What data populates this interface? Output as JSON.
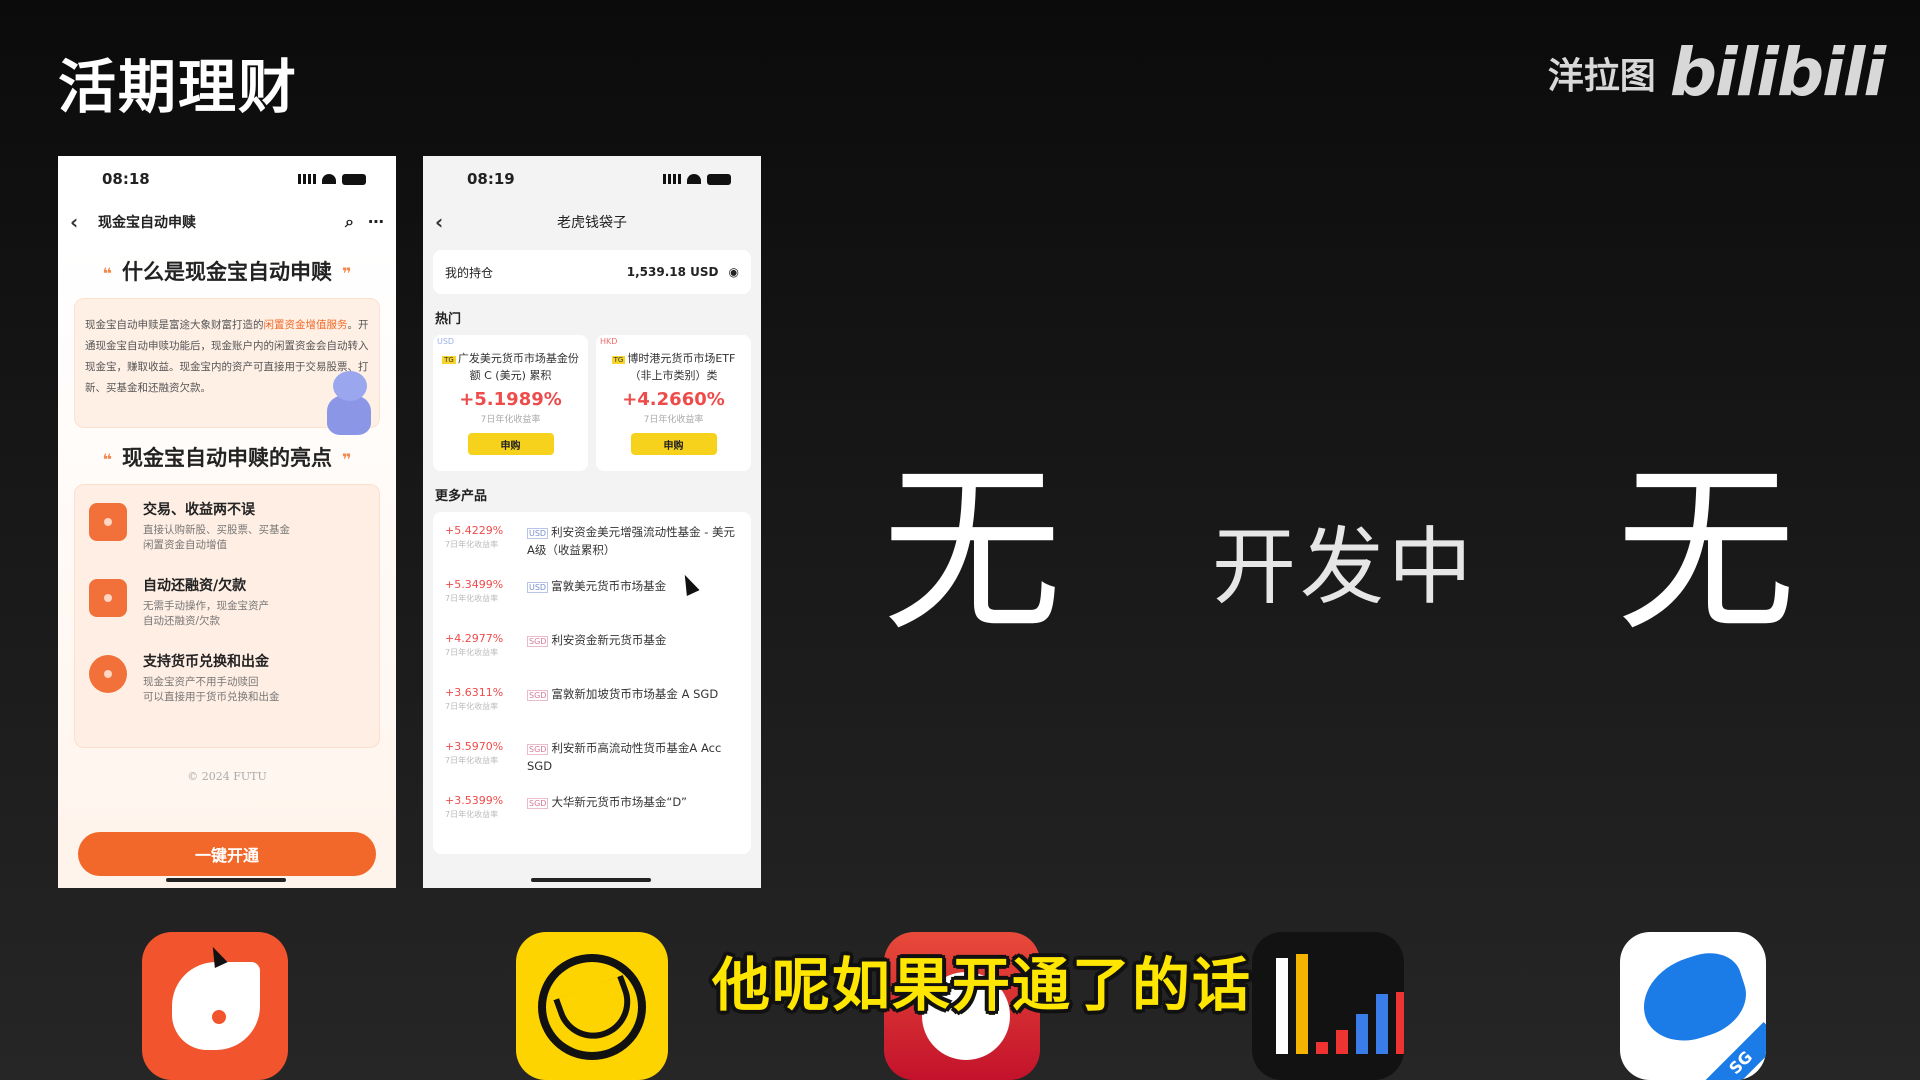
{
  "slide": {
    "title": "活期理财",
    "brand_author": "洋拉图",
    "brand_site": "bilibili"
  },
  "phone1": {
    "time": "08:18",
    "nav_title": "现金宝自动申赎",
    "section1_title": "什么是现金宝自动申赎",
    "intro_pre": "现金宝自动申赎是富途大象财富打造的",
    "intro_highlight": "闲置资金增值服务",
    "intro_post": "。开通现金宝自动申赎功能后，现金账户内的闲置资金会自动转入现金宝，赚取收益。现金宝内的资产可直接用于交易股票、打新、买基金和还融资欠款。",
    "section2_title": "现金宝自动申赎的亮点",
    "features": [
      {
        "title": "交易、收益两不误",
        "desc": "直接认购新股、买股票、买基金\n闲置资金自动增值"
      },
      {
        "title": "自动还融资/欠款",
        "desc": "无需手动操作，现金宝资产\n自动还融资/欠款"
      },
      {
        "title": "支持货币兑换和出金",
        "desc": "现金宝资产不用手动赎回\n可以直接用于货币兑换和出金"
      }
    ],
    "copyright": "© 2024 FUTU",
    "cta": "一键开通"
  },
  "phone2": {
    "time": "08:19",
    "nav_title": "老虎钱袋子",
    "holding_label": "我的持仓",
    "holding_value": "1,539.18 USD",
    "hot_label": "热门",
    "hot": [
      {
        "ccy": "USD",
        "tag": "TG",
        "name": "广发美元货币市场基金份额 C (美元) 累积",
        "rate": "+5.1989%",
        "sub": "7日年化收益率",
        "btn": "申购"
      },
      {
        "ccy": "HKD",
        "tag": "TG",
        "name": "博时港元货币市场ETF（非上市类别）类",
        "rate": "+4.2660%",
        "sub": "7日年化收益率",
        "btn": "申购"
      }
    ],
    "more_label": "更多产品",
    "products": [
      {
        "rate": "+5.4229%",
        "sub": "7日年化收益率",
        "ccy": "USD",
        "name": "利安资金美元增强流动性基金 - 美元A级（收益累积）"
      },
      {
        "rate": "+5.3499%",
        "sub": "7日年化收益率",
        "ccy": "USD",
        "name": "富敦美元货币市场基金"
      },
      {
        "rate": "+4.2977%",
        "sub": "7日年化收益率",
        "ccy": "SGD",
        "name": "利安资金新元货币基金"
      },
      {
        "rate": "+3.6311%",
        "sub": "7日年化收益率",
        "ccy": "SGD",
        "name": "富敦新加坡货币市场基金 A SGD"
      },
      {
        "rate": "+3.5970%",
        "sub": "7日年化收益率",
        "ccy": "SGD",
        "name": "利安新币高流动性货币基金A Acc SGD"
      },
      {
        "rate": "+3.5399%",
        "sub": "7日年化收益率",
        "ccy": "SGD",
        "name": "大华新元货币市场基金“D”"
      }
    ]
  },
  "columns": {
    "col3": "无",
    "col4": "开发中",
    "col5": "无"
  },
  "apps": {
    "app5_tag": "SG"
  },
  "subtitle": "他呢如果开通了的话",
  "colors": {
    "futu_orange": "#f2682a",
    "tiger_yellow": "#fdd400",
    "rate_red": "#ee4b4b",
    "subtitle_yellow": "#ffe600"
  }
}
